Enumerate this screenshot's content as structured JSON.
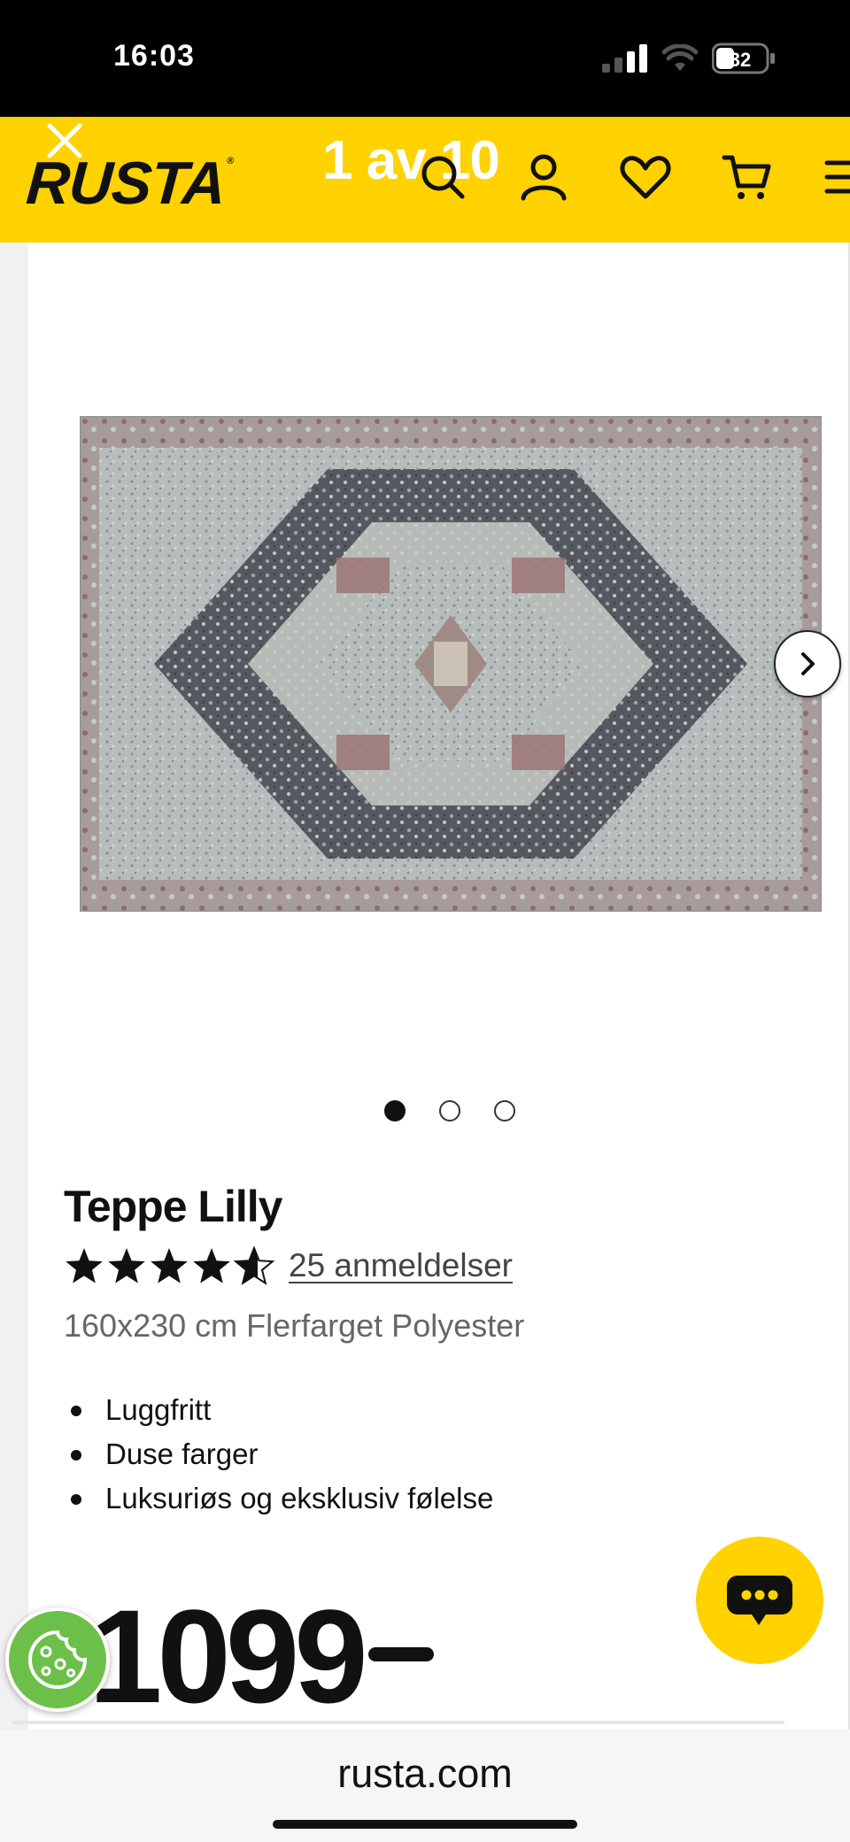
{
  "status_bar": {
    "time": "16:03",
    "battery": "32"
  },
  "header": {
    "logo": "RUSTA",
    "gallery_counter": "1 av 10",
    "icons": [
      "search-icon",
      "user-icon",
      "heart-icon",
      "cart-icon",
      "menu-icon"
    ],
    "accent_color": "#ffd200"
  },
  "gallery": {
    "total_dots": 3,
    "active_dot": 0
  },
  "product": {
    "title": "Teppe Lilly",
    "rating": 4.5,
    "max_rating": 5,
    "reviews_label": "25 anmeldelser",
    "subtitle": "160x230 cm Flerfarget Polyester",
    "features": [
      "Luggfritt",
      "Duse farger",
      "Luksuriøs og eksklusiv følelse"
    ],
    "price": "1099"
  },
  "address_bar": {
    "url": "rusta.com"
  }
}
